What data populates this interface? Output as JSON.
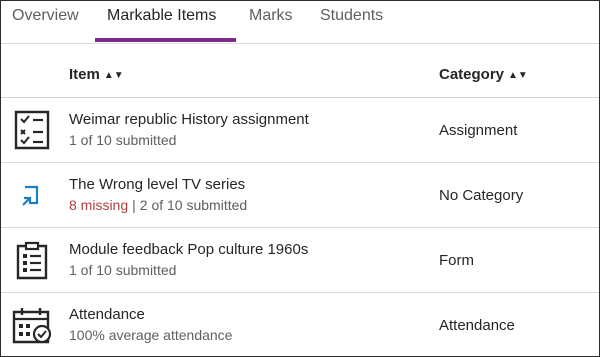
{
  "tabs": [
    {
      "label": "Overview"
    },
    {
      "label": "Markable Items"
    },
    {
      "label": "Marks"
    },
    {
      "label": "Students"
    }
  ],
  "active_tab": "Markable Items",
  "colors": {
    "accent": "#7d2a8f",
    "missing": "#b04040",
    "icon_blue": "#1b7fc4"
  },
  "columns": {
    "item": "Item",
    "category": "Category",
    "sort_icon": "sort-both-icon"
  },
  "rows": [
    {
      "icon": "checklist-document-icon",
      "title": "Weimar republic History assignment",
      "status": "1 of 10 submitted",
      "category": "Assignment"
    },
    {
      "icon": "external-link-blue-icon",
      "title": "The Wrong level TV series",
      "missing": "8 missing",
      "separator": "|",
      "status": "2 of 10 submitted",
      "category": "No Category"
    },
    {
      "icon": "clipboard-form-icon",
      "title": "Module feedback Pop culture 1960s",
      "status": "1 of 10 submitted",
      "category": "Form"
    },
    {
      "icon": "calendar-check-icon",
      "title": "Attendance",
      "status": "100% average attendance",
      "category": "Attendance"
    }
  ]
}
